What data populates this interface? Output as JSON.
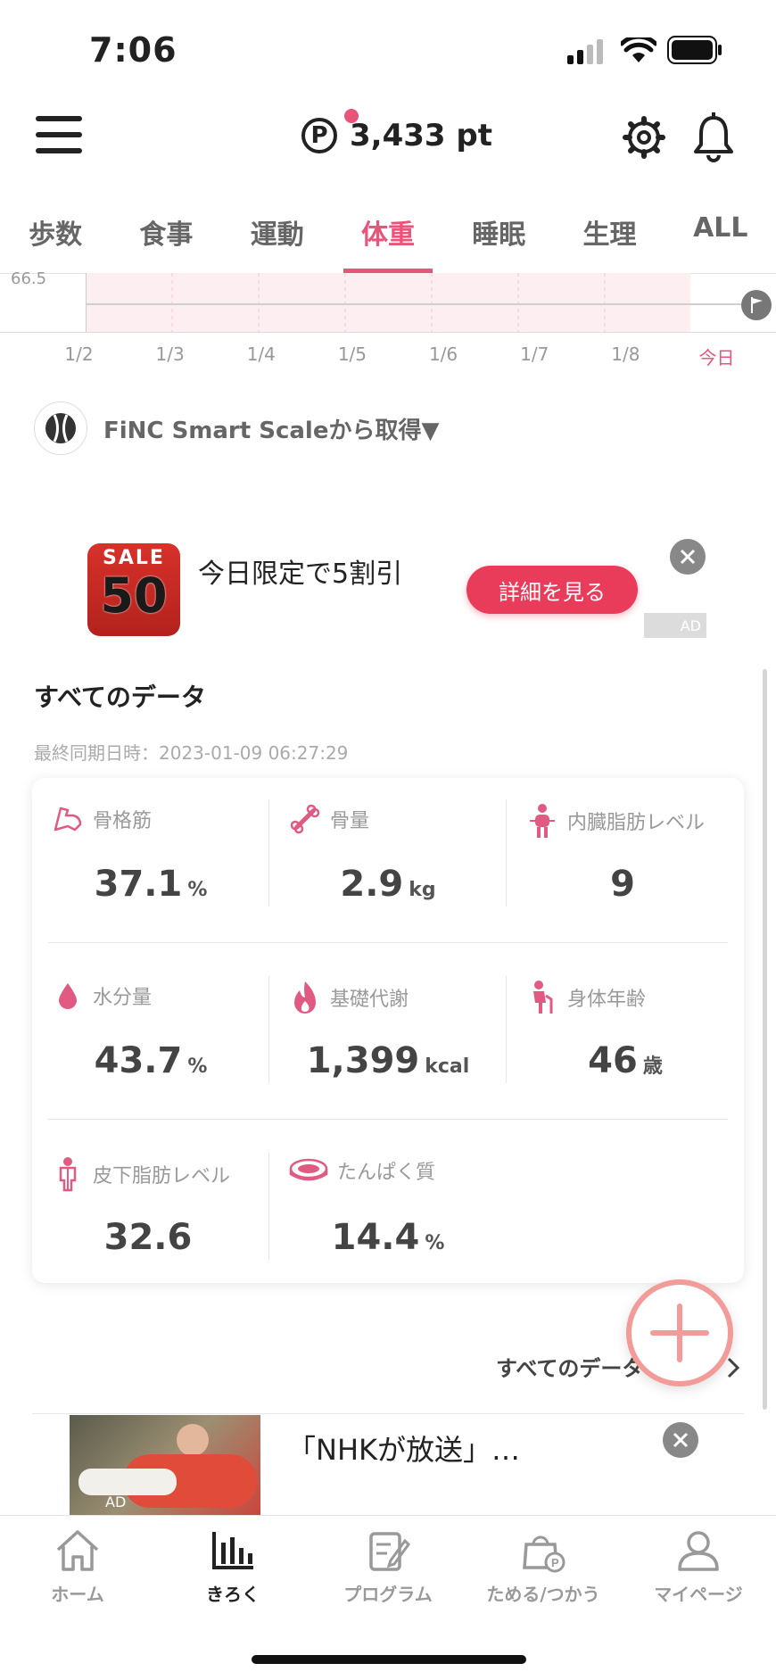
{
  "status": {
    "time": "7:06"
  },
  "header": {
    "points_icon": "P",
    "points": "3,433 pt"
  },
  "tabs": [
    {
      "label": "歩数"
    },
    {
      "label": "食事"
    },
    {
      "label": "運動"
    },
    {
      "label": "体重",
      "active": true
    },
    {
      "label": "睡眠"
    },
    {
      "label": "生理"
    },
    {
      "label": "ALL"
    }
  ],
  "graph": {
    "y_label": "66.5",
    "x_labels": [
      "1/2",
      "1/3",
      "1/4",
      "1/5",
      "1/6",
      "1/7",
      "1/8",
      "今日"
    ]
  },
  "source": {
    "label": "FiNC Smart Scaleから取得▼"
  },
  "ad": {
    "image_sale": "SALE",
    "image_pct": "50",
    "text": "今日限定で5割引",
    "button": "詳細を見る",
    "badge": "AD"
  },
  "section": {
    "title": "すべてのデータ",
    "sync": "最終同期日時：2023-01-09 06:27:29",
    "metrics": [
      {
        "label": "骨格筋",
        "value": "37.1",
        "unit": "%",
        "icon": "muscle-icon"
      },
      {
        "label": "骨量",
        "value": "2.9",
        "unit": "kg",
        "icon": "bone-icon"
      },
      {
        "label": "内臓脂肪レベル",
        "value": "9",
        "unit": "",
        "icon": "visceral-fat-icon"
      },
      {
        "label": "水分量",
        "value": "43.7",
        "unit": "%",
        "icon": "water-drop-icon"
      },
      {
        "label": "基礎代謝",
        "value": "1,399",
        "unit": "kcal",
        "icon": "flame-icon"
      },
      {
        "label": "身体年齢",
        "value": "46",
        "unit": "歳",
        "icon": "body-age-icon"
      },
      {
        "label": "皮下脂肪レベル",
        "value": "32.6",
        "unit": "",
        "icon": "subcutaneous-fat-icon"
      },
      {
        "label": "たんぱく質",
        "value": "14.4",
        "unit": "%",
        "icon": "meat-icon"
      }
    ],
    "all_link": "すべてのデータ"
  },
  "ad2": {
    "text": "「NHKが放送」…",
    "badge": "AD"
  },
  "nav": [
    {
      "label": "ホーム",
      "icon": "home-icon"
    },
    {
      "label": "きろく",
      "icon": "chart-icon",
      "active": true
    },
    {
      "label": "プログラム",
      "icon": "program-icon"
    },
    {
      "label": "ためる/つかう",
      "icon": "points-bag-icon"
    },
    {
      "label": "マイページ",
      "icon": "profile-icon"
    }
  ]
}
